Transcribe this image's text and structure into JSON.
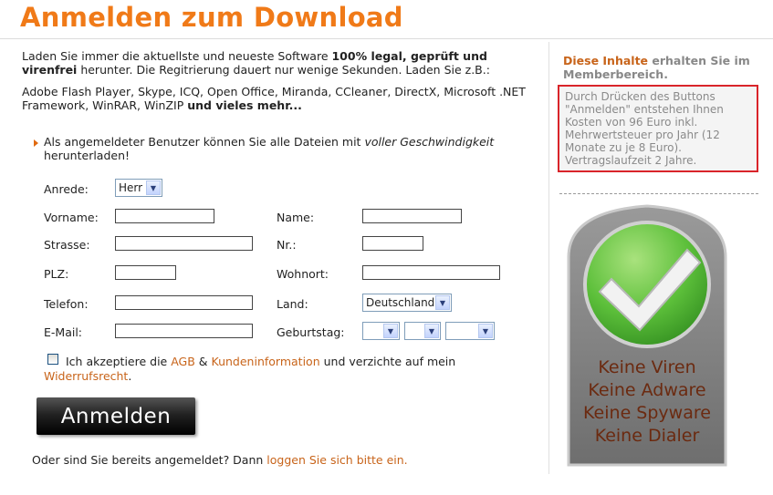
{
  "title": "Anmelden zum Download",
  "intro": {
    "line1_pre": "Laden Sie immer die aktuellste und neueste Software ",
    "line1_bold": "100% legal, geprüft und",
    "line2_bold": "virenfrei",
    "line2_post": " herunter. Die Regitrierung dauert nur wenige Sekunden. Laden Sie z.B.:",
    "list_line1": "Adobe Flash Player, Skype, ICQ, Open Office, Miranda, CCleaner, DirectX, Microsoft .NET",
    "list_line2_pre": "Framework, WinRAR, WinZIP ",
    "list_line2_bold": "und vieles mehr..."
  },
  "member_note": {
    "pre": "Als angemeldeter Benutzer können Sie alle Dateien mit ",
    "italic": "voller Geschwindigkeit",
    "line2": "herunterladen!"
  },
  "form": {
    "anrede_label": "Anrede:",
    "anrede_value": "Herr",
    "vorname_label": "Vorname:",
    "name_label": "Name:",
    "strasse_label": "Strasse:",
    "nr_label": "Nr.:",
    "plz_label": "PLZ:",
    "wohnort_label": "Wohnort:",
    "telefon_label": "Telefon:",
    "land_label": "Land:",
    "land_value": "Deutschland",
    "email_label": "E-Mail:",
    "geburtstag_label": "Geburtstag:"
  },
  "agb": {
    "pre": "Ich akzeptiere die ",
    "agb_link": "AGB",
    "amp": " & ",
    "kunden_link": "Kundeninformation",
    "post": " und verzichte auf mein",
    "widerruf_link": "Widerrufsrecht",
    "dot": "."
  },
  "submit_label": "Anmelden",
  "login": {
    "pre": "Oder sind Sie bereits angemeldet? Dann ",
    "link": "loggen Sie sich bitte ein",
    "dot": "."
  },
  "sidebar": {
    "heading_orange": "Diese Inhalte",
    "heading_rest1": " erhalten Sie im",
    "heading_rest2": "Memberbereich.",
    "notice": "Durch Drücken des Buttons \"Anmelden\" entstehen Ihnen Kosten von 96 Euro inkl. Mehrwertsteuer pro Jahr (12 Monate zu je 8 Euro). Vertragslaufzeit 2 Jahre.",
    "badge_lines": [
      "Keine Viren",
      "Keine Adware",
      "Keine Spyware",
      "Keine Dialer"
    ]
  },
  "colors": {
    "accent": "#f07a18",
    "link": "#c8641a",
    "notice_border": "#d9242a",
    "check_green": "#5cbf3a"
  }
}
